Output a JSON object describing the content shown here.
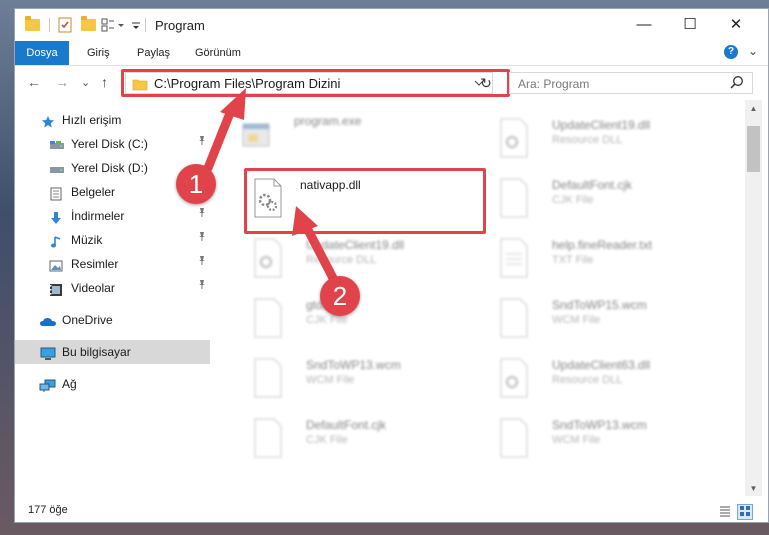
{
  "window": {
    "title": "Program",
    "controls": {
      "minimize": "—",
      "maximize": "☐",
      "close": "✕"
    }
  },
  "ribbon": {
    "tabs": [
      "Dosya",
      "Giriş",
      "Paylaş",
      "Görünüm"
    ],
    "expand": "⌄",
    "help": "?"
  },
  "navigation": {
    "back": "←",
    "forward": "→",
    "recent": "⌄",
    "up": "↑",
    "address": "C:\\Program Files\\Program Dizini",
    "refresh": "↻",
    "search_placeholder": "Ara: Program"
  },
  "sidebar": {
    "items": [
      {
        "label": "Hızlı erişim",
        "icon": "star-icon",
        "pinned": false
      },
      {
        "label": "Yerel Disk (C:)",
        "icon": "drive-icon",
        "pinned": true
      },
      {
        "label": "Yerel Disk (D:)",
        "icon": "drive-icon",
        "pinned": false
      },
      {
        "label": "Belgeler",
        "icon": "document-icon",
        "pinned": true
      },
      {
        "label": "İndirmeler",
        "icon": "download-icon",
        "pinned": true
      },
      {
        "label": "Müzik",
        "icon": "music-icon",
        "pinned": true
      },
      {
        "label": "Resimler",
        "icon": "pictures-icon",
        "pinned": true
      },
      {
        "label": "Videolar",
        "icon": "videos-icon",
        "pinned": true
      },
      {
        "label": "OneDrive",
        "icon": "cloud-icon",
        "pinned": false
      },
      {
        "label": "Bu bilgisayar",
        "icon": "computer-icon",
        "pinned": false,
        "selected": true
      },
      {
        "label": "Ağ",
        "icon": "network-icon",
        "pinned": false
      }
    ],
    "pin_glyph": "📌"
  },
  "files": [
    {
      "name": "program.exe",
      "type": ""
    },
    {
      "name": "UpdateClient19.dll",
      "type": "Resource DLL"
    },
    {
      "name": "nativapp.dll",
      "type": ""
    },
    {
      "name": "DefaultFont.cjk",
      "type": "CJK File"
    },
    {
      "name": "UpdateClient19.dll",
      "type": "Resource DLL"
    },
    {
      "name": "help.fineReader.txt",
      "type": "TXT File"
    },
    {
      "name": "gtd.cjk",
      "type": "CJK File"
    },
    {
      "name": "SndToWP15.wcm",
      "type": "WCM File"
    },
    {
      "name": "SndToWP13.wcm",
      "type": "WCM File"
    },
    {
      "name": "UpdateClient63.dll",
      "type": "Resource DLL"
    },
    {
      "name": "DefaultFont.cjk",
      "type": "CJK File"
    },
    {
      "name": "SndToWP13.wcm",
      "type": "WCM File"
    }
  ],
  "annotations": {
    "step1": "1",
    "step2": "2"
  },
  "status": {
    "item_count": "177 öğe"
  },
  "colors": {
    "accent": "#1979ca",
    "highlight": "#e0444a",
    "selected": "#d8d8d8"
  }
}
